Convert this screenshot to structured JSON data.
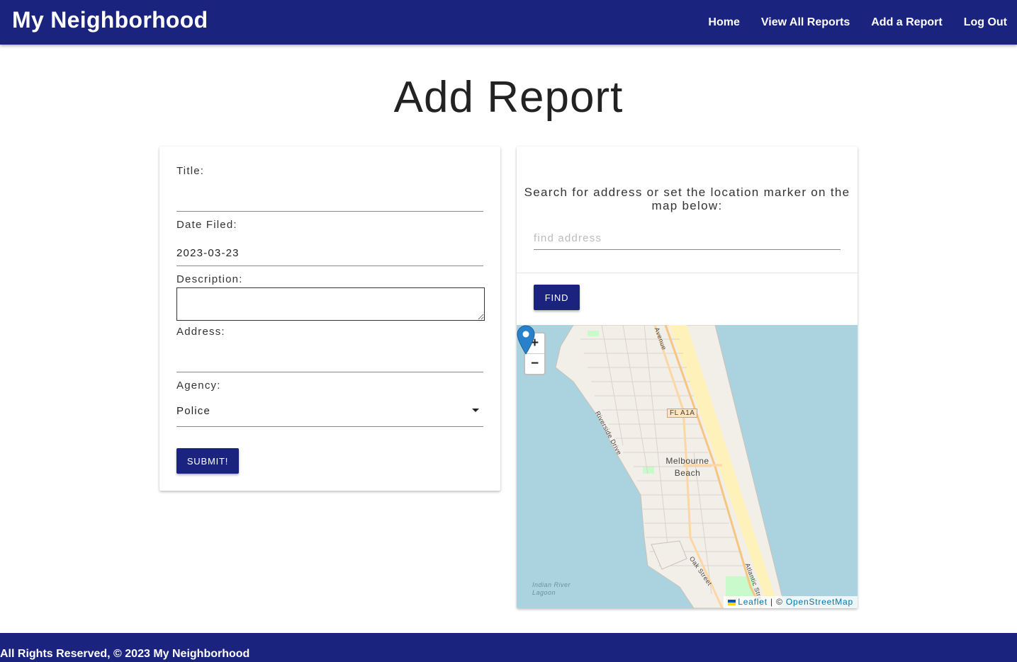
{
  "nav": {
    "brand": "My Neighborhood",
    "links": [
      "Home",
      "View All Reports",
      "Add a Report",
      "Log Out"
    ]
  },
  "page": {
    "title": "Add Report"
  },
  "form": {
    "title_label": "Title:",
    "title_value": "",
    "date_label": "Date Filed:",
    "date_value": "2023-03-23",
    "description_label": "Description:",
    "description_value": "",
    "address_label": "Address:",
    "address_value": "",
    "agency_label": "Agency:",
    "agency_value": "Police",
    "submit_label": "SUBMIT!"
  },
  "search": {
    "instruction": "Search for address or set the location marker on the map below:",
    "placeholder": "find address",
    "find_label": "FIND"
  },
  "map": {
    "zoom_in": "+",
    "zoom_out": "−",
    "place_label": "Melbourne Beach",
    "road_badge": "FL A1A",
    "water_label": "Indian River Lagoon",
    "streets": [
      "Riverside Drive",
      "Oak Street",
      "Atlantic Street",
      "Avenue"
    ],
    "attribution": {
      "leaflet": "Leaflet",
      "separator": "|",
      "copyright": "©",
      "osm": "OpenStreetMap"
    },
    "colors": {
      "water": "#aad3df",
      "land": "#f2efe9",
      "beach": "#fff1ba",
      "road": "#fcd6a4",
      "marker": "#2a81cb"
    }
  },
  "footer": {
    "text": "All Rights Reserved, © 2023 My Neighborhood"
  }
}
